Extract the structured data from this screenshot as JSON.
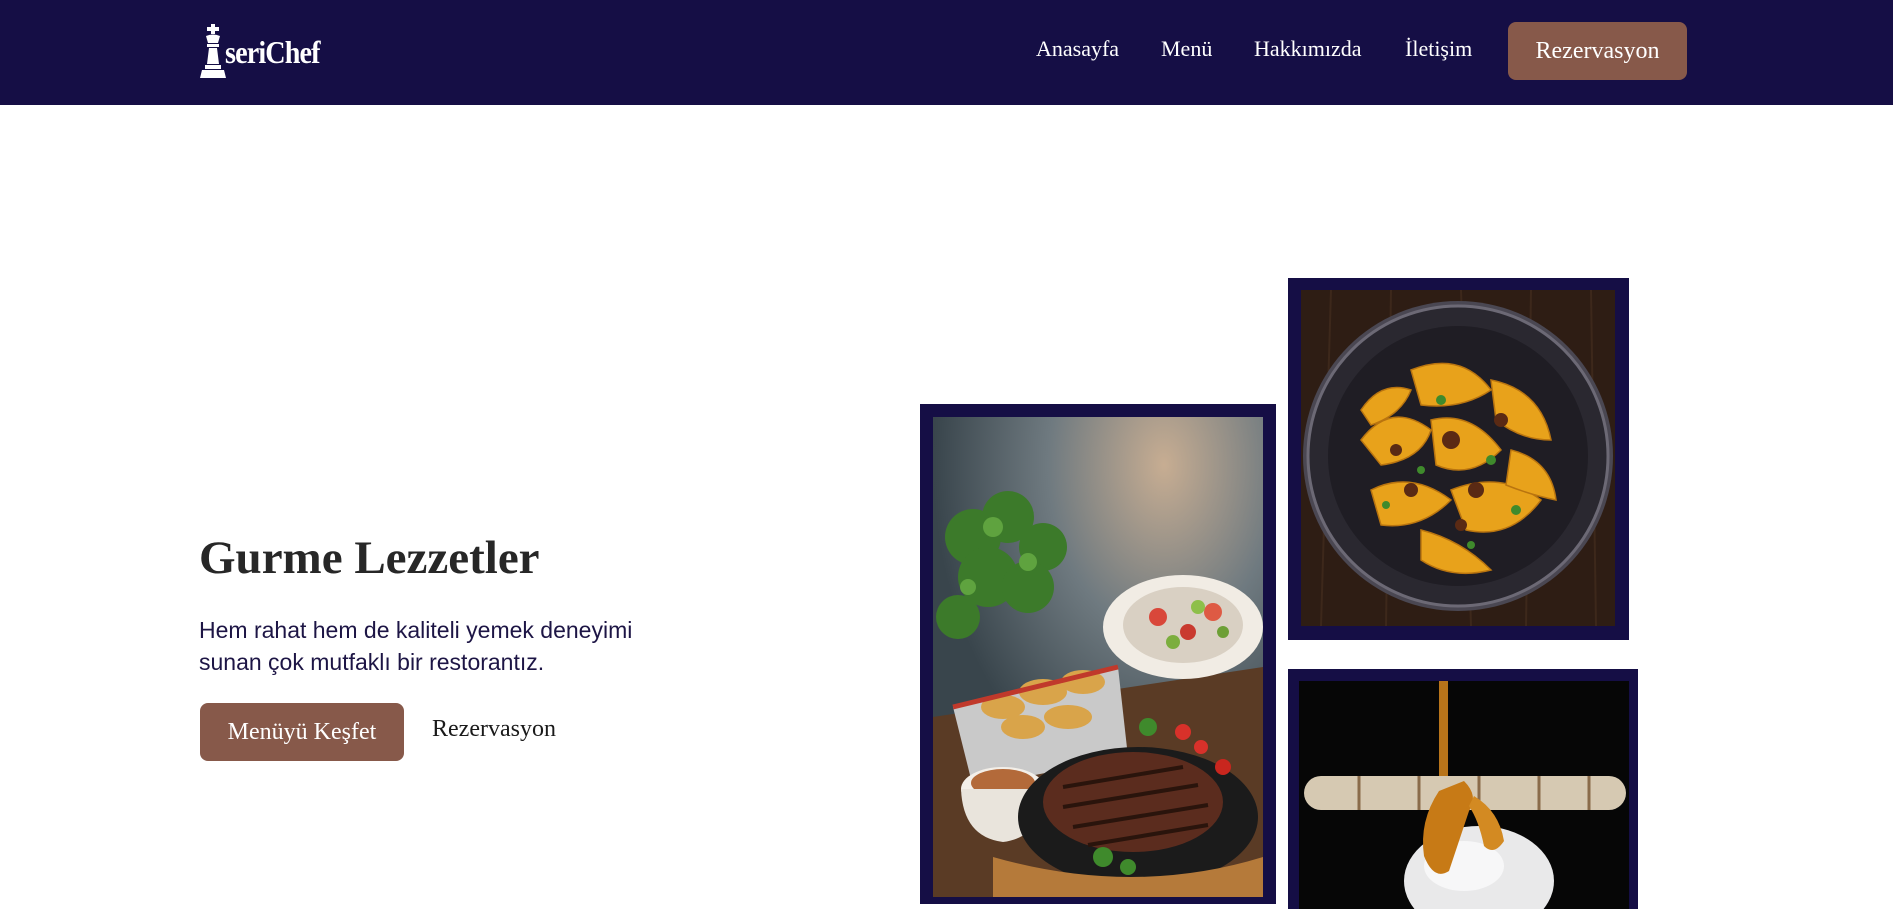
{
  "brand": {
    "name": "İseriChef",
    "logo_text": "seriChef",
    "logo_icon": "chess-king-icon"
  },
  "nav": {
    "items": [
      {
        "label": "Anasayfa"
      },
      {
        "label": "Menü"
      },
      {
        "label": "Hakkımızda"
      },
      {
        "label": "İletişim"
      }
    ],
    "cta_label": "Rezervasyon"
  },
  "hero": {
    "title": "Gurme Lezzetler",
    "text": "Hem rahat hem de kaliteli yemek deneyimi sunan çok mutfaklı bir restorantız.",
    "primary_button": "Menüyü Keşfet",
    "secondary_link": "Rezervasyon"
  },
  "gallery": [
    {
      "subject": "grilled-steak-platter"
    },
    {
      "subject": "pasta-bowl"
    },
    {
      "subject": "caramel-ice-cream-dessert"
    }
  ],
  "colors": {
    "navbar_bg": "#150e45",
    "accent": "#87594a",
    "heading": "#272727",
    "body_text": "#1d1545"
  }
}
